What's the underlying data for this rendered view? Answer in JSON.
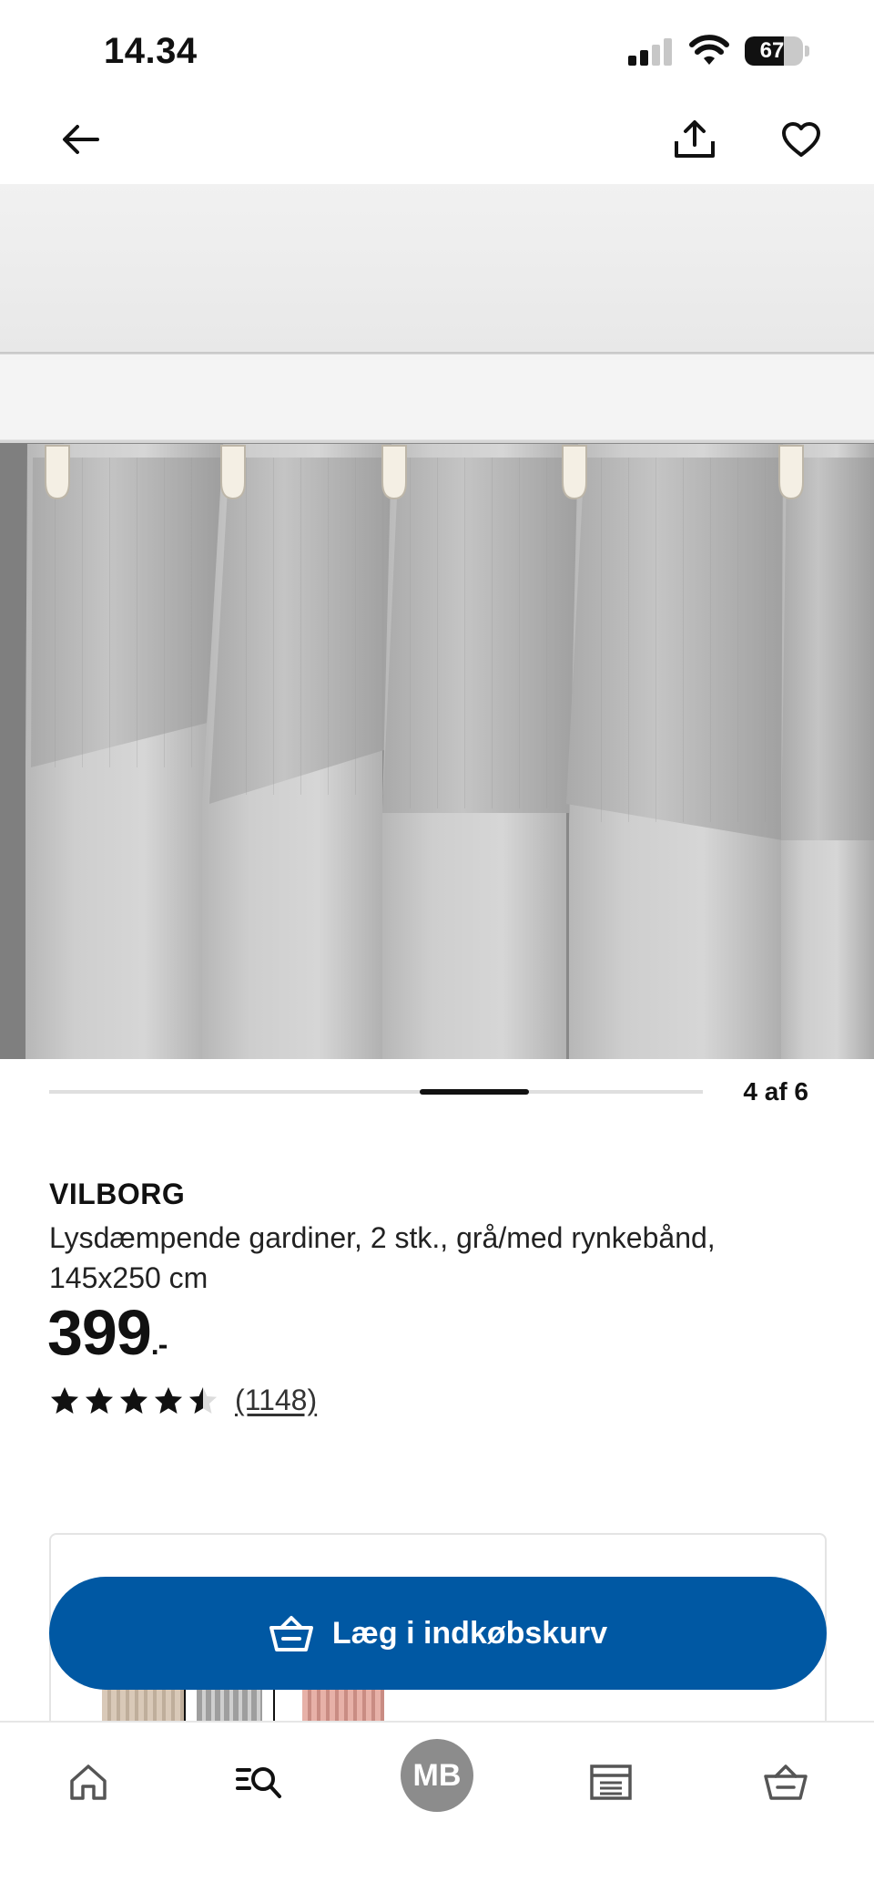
{
  "status_bar": {
    "time": "14.34",
    "battery": "67",
    "battery_level_percent": 67
  },
  "nav": {
    "back_icon": "arrow-left-icon",
    "share_icon": "share-icon",
    "favorite_icon": "heart-icon"
  },
  "gallery": {
    "counter": "4 af 6",
    "current": 4,
    "total": 6
  },
  "product": {
    "name": "VILBORG",
    "description": "Lysdæmpende gardiner, 2 stk., grå/med rynkebånd, 145x250 cm",
    "price": "399",
    "price_suffix": ".-",
    "rating": 4.5,
    "rating_max": 5,
    "review_count": "(1148)"
  },
  "cart_button": {
    "label": "Læg i indkøbskurv",
    "icon": "basket-icon",
    "color": "#0058a3"
  },
  "tab_bar": {
    "items": [
      {
        "icon": "home-icon"
      },
      {
        "icon": "search-list-icon",
        "active": true
      },
      {
        "avatar_text": "MB"
      },
      {
        "icon": "store-icon"
      },
      {
        "icon": "basket-icon"
      }
    ],
    "avatar": "MB"
  }
}
